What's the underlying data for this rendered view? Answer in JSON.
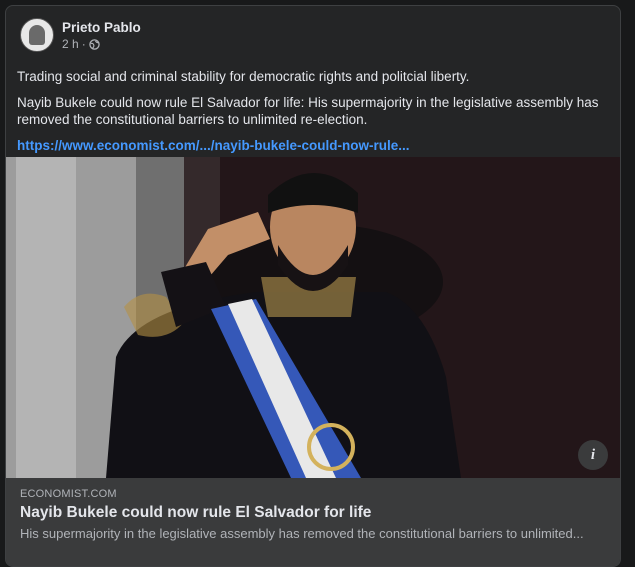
{
  "post": {
    "author": "Prieto Pablo",
    "time": "2 h",
    "separator": "·",
    "privacy_icon": "globe-icon",
    "text_1": "Trading social and criminal stability for democratic rights and politcial liberty.",
    "text_2": "Nayib Bukele could now rule El Salvador for life: His supermajority in the legislative assembly has removed the constitutional barriers to unlimited re-election.",
    "link": "https://www.economist.com/.../nayib-bukele-could-now-rule..."
  },
  "preview": {
    "domain": "ECONOMIST.COM",
    "title": "Nayib Bukele could now rule El Salvador for life",
    "subtitle": "His supermajority in the legislative assembly has removed the constitutional barriers to unlimited...",
    "info_label": "i"
  },
  "colors": {
    "background": "#18191a",
    "card": "#242526",
    "link": "#4599ff",
    "caption": "#3a3b3c"
  }
}
